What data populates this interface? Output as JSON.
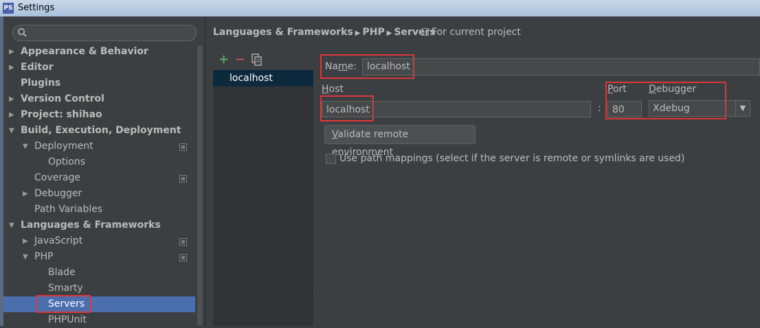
{
  "window": {
    "title": "Settings",
    "app_icon": "phpstorm-icon"
  },
  "search": {
    "placeholder": ""
  },
  "sidebar": {
    "items": [
      {
        "label": "Appearance & Behavior",
        "arrow": "▶"
      },
      {
        "label": "Editor",
        "arrow": "▶"
      },
      {
        "label": "Plugins",
        "arrow": ""
      },
      {
        "label": "Version Control",
        "arrow": "▶"
      },
      {
        "label": "Project: shihao",
        "arrow": "▶"
      },
      {
        "label": "Build, Execution, Deployment",
        "arrow": "▼"
      },
      {
        "label": "Deployment",
        "arrow": "▼"
      },
      {
        "label": "Options",
        "arrow": ""
      },
      {
        "label": "Coverage",
        "arrow": ""
      },
      {
        "label": "Debugger",
        "arrow": "▶"
      },
      {
        "label": "Path Variables",
        "arrow": ""
      },
      {
        "label": "Languages & Frameworks",
        "arrow": "▼"
      },
      {
        "label": "JavaScript",
        "arrow": "▶"
      },
      {
        "label": "PHP",
        "arrow": "▼"
      },
      {
        "label": "Blade",
        "arrow": ""
      },
      {
        "label": "Smarty",
        "arrow": ""
      },
      {
        "label": "Servers",
        "arrow": ""
      },
      {
        "label": "PHPUnit",
        "arrow": ""
      }
    ]
  },
  "breadcrumb": {
    "part1": "Languages & Frameworks",
    "part2": "PHP",
    "part3": "Servers",
    "separator": "▶",
    "scope": "For current project"
  },
  "toolbar": {
    "add": "+",
    "remove": "−",
    "copy_icon": "copy-icon"
  },
  "servers": {
    "items": [
      "localhost"
    ]
  },
  "form": {
    "name_label_mnemonic": "m",
    "name_label_a": "Na",
    "name_label_b": "e:",
    "name_value": "localhost",
    "host_label_mnemonic": "H",
    "host_label_rest": "ost",
    "host_value": "localhost",
    "colon": ":",
    "port_label_mnemonic": "P",
    "port_label_rest": "ort",
    "port_value": "80",
    "debugger_label_mnemonic": "D",
    "debugger_label_rest": "ebugger",
    "debugger_value": "Xdebug",
    "validate_mnemonic": "V",
    "validate_rest": "alidate remote environment",
    "path_mappings_label": "Use path mappings (select if the server is remote or symlinks are used)",
    "path_mappings_checked": false
  },
  "colors": {
    "background": "#3c3f41",
    "selection": "#4b6eaf",
    "list_selection": "#0d293e",
    "annotation": "#e0353a",
    "add": "#59a869",
    "remove": "#c75450"
  }
}
